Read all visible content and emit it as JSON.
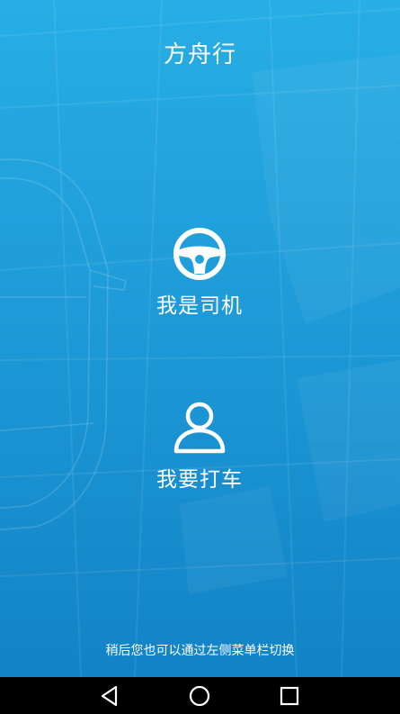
{
  "app": {
    "title": "方舟行"
  },
  "roles": {
    "driver": {
      "label": "我是司机",
      "icon": "steering-wheel-icon"
    },
    "passenger": {
      "label": "我要打车",
      "icon": "person-icon"
    }
  },
  "hint": "稍后您也可以通过左侧菜单栏切换",
  "nav_bar": {
    "back_icon": "back-triangle-icon",
    "home_icon": "home-circle-icon",
    "recent_icon": "recent-apps-square-icon"
  },
  "colors": {
    "background_top": "#27aee5",
    "background_bottom": "#1283c6",
    "text": "#ffffff",
    "nav_bar": "#000000"
  }
}
